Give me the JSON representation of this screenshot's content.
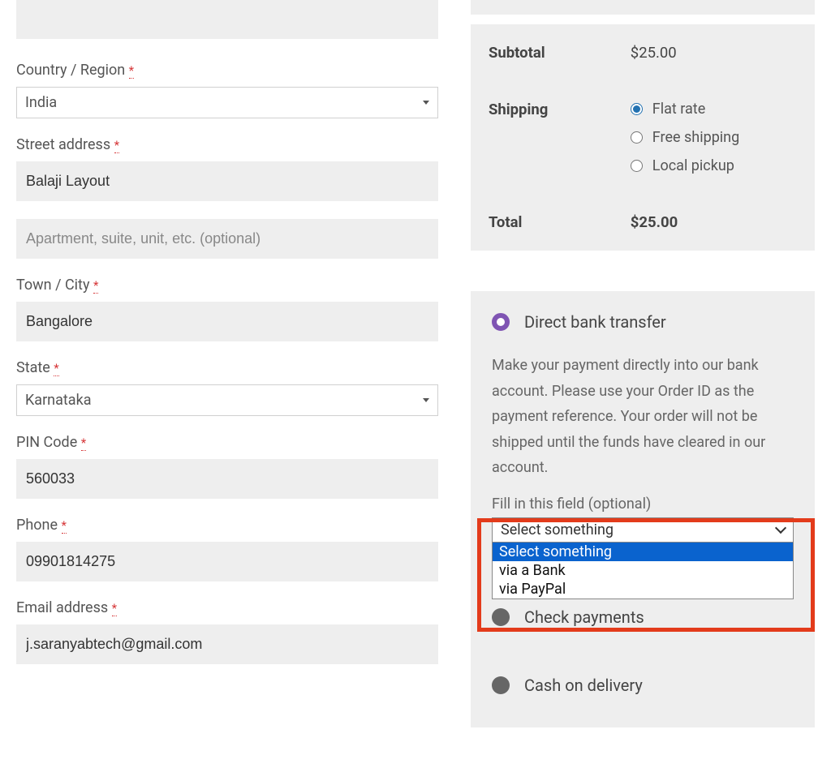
{
  "billing": {
    "country_label": "Country / Region",
    "country_value": "India",
    "street_label": "Street address",
    "street_value": "Balaji Layout",
    "street2_placeholder": "Apartment, suite, unit, etc. (optional)",
    "city_label": "Town / City",
    "city_value": "Bangalore",
    "state_label": "State",
    "state_value": "Karnataka",
    "pin_label": "PIN Code",
    "pin_value": "560033",
    "phone_label": "Phone",
    "phone_value": "09901814275",
    "email_label": "Email address",
    "email_value": "j.saranyabtech@gmail.com",
    "required_mark": "*"
  },
  "summary": {
    "subtotal_label": "Subtotal",
    "subtotal_value": "$25.00",
    "shipping_label": "Shipping",
    "shipping_options": {
      "flat": "Flat rate",
      "free": "Free shipping",
      "local": "Local pickup"
    },
    "total_label": "Total",
    "total_value": "$25.00"
  },
  "payment": {
    "bank_transfer_label": "Direct bank transfer",
    "bank_transfer_desc": "Make your payment directly into our bank account. Please use your Order ID as the payment reference. Your order will not be shipped until the funds have cleared in our account.",
    "aux_label": "Fill in this field (optional)",
    "aux_selected": "Select something",
    "aux_options": {
      "placeholder": "Select something",
      "bank": "via a Bank",
      "paypal": "via PayPal"
    },
    "check_label": "Check payments",
    "cod_label": "Cash on delivery"
  }
}
